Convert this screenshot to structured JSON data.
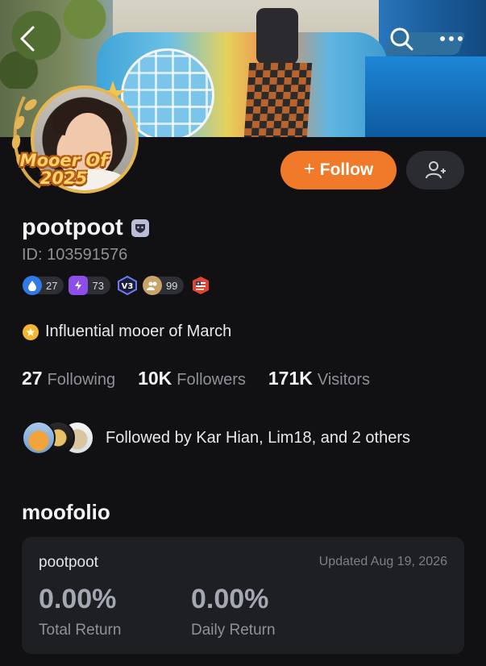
{
  "profile": {
    "username": "pootpoot",
    "id_text": "ID: 103591576",
    "avatar_badge": "Mooer Of 2025",
    "achievement": "Influential mooer of March",
    "followed_by": "Followed by Kar Hian, Lim18, and 2 others"
  },
  "actions": {
    "follow_plus": "+",
    "follow_label": "Follow"
  },
  "badges": [
    {
      "icon": "droplet-icon",
      "value": "27",
      "color": "#2f7ae5"
    },
    {
      "icon": "lightning-icon",
      "value": "73",
      "color": "#8c4de8"
    },
    {
      "icon": "v3-icon",
      "value": "V3",
      "color": "#4a5bd6"
    },
    {
      "icon": "community-icon",
      "value": "99",
      "color": "#c9a46a"
    },
    {
      "icon": "malaysia-flag-icon",
      "color": "#e0452f"
    }
  ],
  "stats": [
    {
      "value": "27",
      "label": "Following"
    },
    {
      "value": "10K",
      "label": "Followers"
    },
    {
      "value": "171K",
      "label": "Visitors"
    }
  ],
  "moofolio": {
    "section_title": "moofolio",
    "portfolio_name": "pootpoot",
    "updated": "Updated Aug 19, 2026",
    "total_return": "0.00%",
    "total_return_label": "Total Return",
    "daily_return": "0.00%",
    "daily_return_label": "Daily Return"
  },
  "colors": {
    "accent": "#f07a2a",
    "background": "#111113",
    "card": "#1e1f23"
  }
}
